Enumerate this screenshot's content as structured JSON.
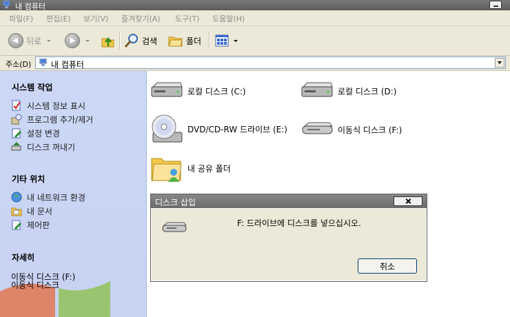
{
  "window": {
    "title": "내 컴퓨터"
  },
  "menu": [
    "파일(F)",
    "편집(E)",
    "보기(V)",
    "즐겨찾기(A)",
    "도구(T)",
    "도움말(H)"
  ],
  "toolbar": {
    "back": "뒤로",
    "search": "검색",
    "folders": "폴더"
  },
  "address": {
    "label": "주소(D)",
    "value": "내 컴퓨터"
  },
  "sidebar": {
    "system_tasks": {
      "title": "시스템 작업",
      "items": [
        "시스템 정보 표시",
        "프로그램 추가/제거",
        "설정 변경",
        "디스크 꺼내기"
      ]
    },
    "other_places": {
      "title": "기타 위치",
      "items": [
        "내 네트워크 환경",
        "내 문서",
        "제어판"
      ]
    },
    "details": {
      "title": "자세히",
      "line1": "이동식 디스크 (F:)",
      "line2": "이동식 디스크"
    }
  },
  "items": {
    "local_c": "로컬 디스크 (C:)",
    "local_d": "로컬 디스크 (D:)",
    "dvd_e": "DVD/CD-RW 드라이브 (E:)",
    "removable_f": "이동식 디스크 (F:)",
    "shared": "내 공유 폴더"
  },
  "dialog": {
    "title": "디스크 삽입",
    "message": "F: 드라이브에 디스크를 넣으십시오.",
    "cancel": "취소"
  }
}
